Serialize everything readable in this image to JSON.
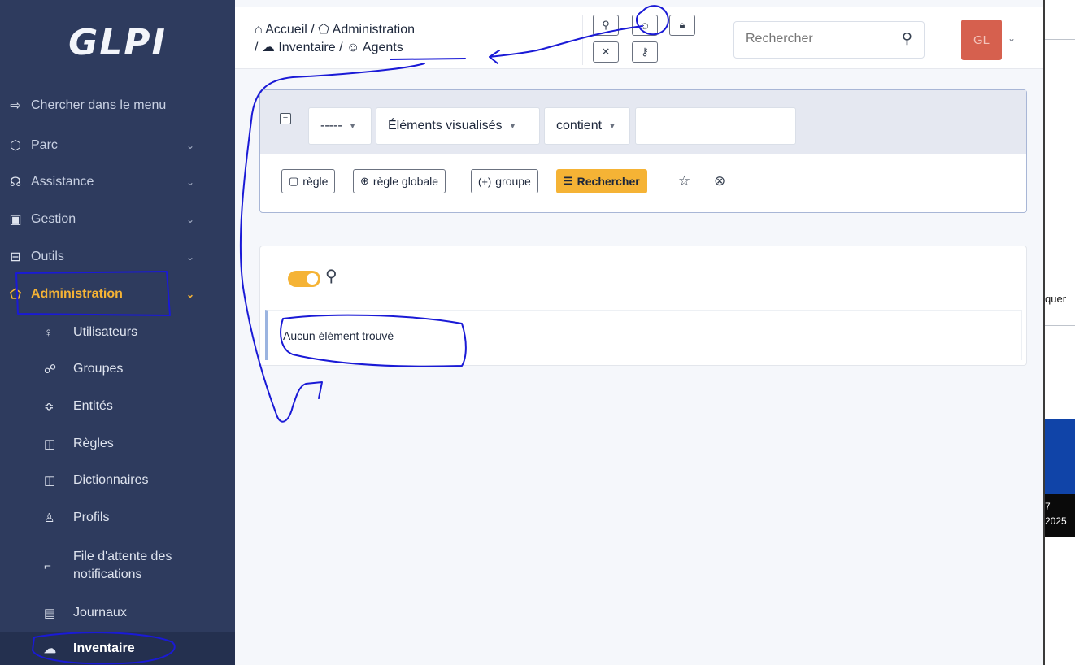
{
  "app": {
    "logo": "GLPI"
  },
  "sidebar": {
    "search_label": "Chercher dans le menu",
    "menu": [
      {
        "label": "Parc",
        "icon": "box-icon"
      },
      {
        "label": "Assistance",
        "icon": "headset-icon"
      },
      {
        "label": "Gestion",
        "icon": "wallet-icon"
      },
      {
        "label": "Outils",
        "icon": "briefcase-icon"
      },
      {
        "label": "Administration",
        "icon": "shield-icon",
        "active": true
      }
    ],
    "submenu": [
      {
        "label": "Utilisateurs",
        "icon": "user-icon"
      },
      {
        "label": "Groupes",
        "icon": "users-icon"
      },
      {
        "label": "Entités",
        "icon": "stack-icon"
      },
      {
        "label": "Règles",
        "icon": "book-icon"
      },
      {
        "label": "Dictionnaires",
        "icon": "book-icon"
      },
      {
        "label": "Profils",
        "icon": "user-check-icon"
      },
      {
        "label": "File d'attente des\nnotifications",
        "icon": "notification-icon"
      },
      {
        "label": "Journaux",
        "icon": "news-icon"
      },
      {
        "label": "Inventaire",
        "icon": "cloud-download-icon",
        "current": true
      }
    ]
  },
  "header": {
    "breadcrumb": {
      "home": "Accueil",
      "admin": "Administration",
      "inventory": "Inventaire",
      "agents": "Agents",
      "separator": "/"
    },
    "search_placeholder": "Rechercher",
    "avatar_initials": "GL"
  },
  "search_panel": {
    "field_select": "-----",
    "criteria_select": "Éléments visualisés",
    "operator_select": "contient",
    "value": "",
    "actions": {
      "rule": "règle",
      "global_rule": "règle globale",
      "group": "groupe",
      "search": "Rechercher"
    }
  },
  "results": {
    "empty_message": "Aucun élément trouvé"
  },
  "right_window": {
    "partial_text": "quer",
    "clock_line1": "7",
    "clock_line2": "2025"
  },
  "colors": {
    "sidebar_bg": "#2e3b5e",
    "accent": "#f5b335",
    "avatar": "#d6604e",
    "annotation": "#1a1ad6"
  }
}
